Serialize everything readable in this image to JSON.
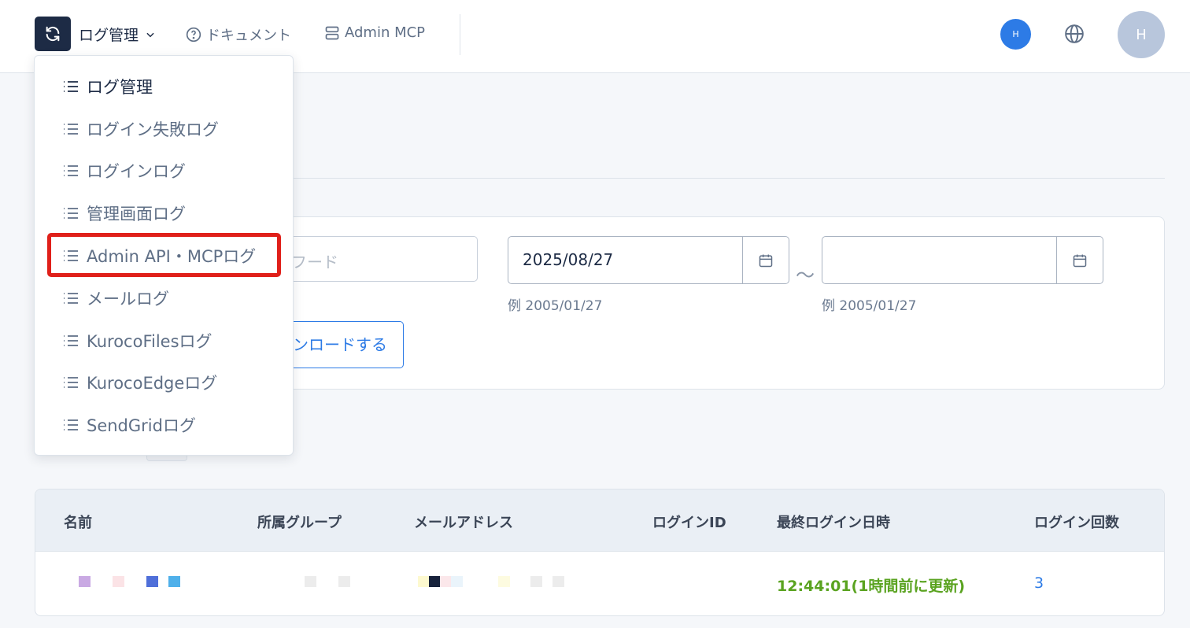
{
  "header": {
    "app_icon": "refresh-icon",
    "menu_label": "ログ管理",
    "docs_label": "ドキュメント",
    "mcp_label": "Admin MCP",
    "small_avatar": "H",
    "user_avatar": "H"
  },
  "menu": {
    "items": [
      {
        "label": "ログ管理",
        "icon": "list-icon"
      },
      {
        "label": "ログイン失敗ログ",
        "icon": "list-icon"
      },
      {
        "label": "ログインログ",
        "icon": "list-icon"
      },
      {
        "label": "管理画面ログ",
        "icon": "list-icon"
      },
      {
        "label": "Admin API・MCPログ",
        "icon": "list-icon"
      },
      {
        "label": "メールログ",
        "icon": "list-icon"
      },
      {
        "label": "KurocoFilesログ",
        "icon": "list-icon"
      },
      {
        "label": "KurocoEdgeログ",
        "icon": "list-icon"
      },
      {
        "label": "SendGridログ",
        "icon": "list-icon"
      }
    ]
  },
  "filter": {
    "keyword_placeholder_partial": "フード",
    "date_from": "2025/08/27",
    "date_to": "",
    "range_separator": "～",
    "date_hint_from": "例 2005/01/27",
    "date_hint_to": "例 2005/01/27",
    "download_label_partial": "ンロードする"
  },
  "table": {
    "headers": [
      "名前",
      "所属グループ",
      "メールアドレス",
      "ログインID",
      "最終ログイン日時",
      "ログイン回数"
    ],
    "rows": [
      {
        "last_login": "12:44:01(1時間前に更新)",
        "login_count": "3"
      }
    ]
  },
  "colors": {
    "accent": "#2d7be6",
    "brand_dark": "#1d2b45",
    "success": "#5aa320",
    "highlight": "#e0201a"
  }
}
